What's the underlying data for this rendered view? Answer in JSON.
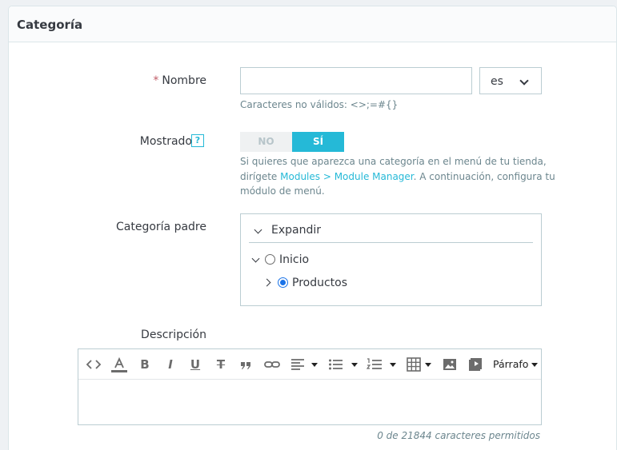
{
  "panel": {
    "title": "Categoría"
  },
  "name_field": {
    "required_mark": "*",
    "label": "Nombre",
    "value": "",
    "placeholder": "",
    "language": "es",
    "help": "Caracteres no válidos: <>;=#{}"
  },
  "displayed": {
    "label": "Mostrado",
    "help_icon": "?",
    "off_label": "NO",
    "on_label": "SÍ",
    "selected": "SÍ",
    "help_text_1": "Si quieres que aparezca una categoría en el menú de tu tienda,",
    "help_text_2_pre": "dirígete ",
    "help_link": "Modules > Module Manager",
    "help_text_2_post": ". A continuación, configura tu",
    "help_text_3": "módulo de menú."
  },
  "parent_category": {
    "label": "Categoría padre",
    "expand_label": "Expandir",
    "items": [
      {
        "label": "Inicio",
        "checked": false
      },
      {
        "label": "Productos",
        "checked": true
      }
    ]
  },
  "description": {
    "label": "Descripción",
    "paragraph_label": "Párrafo",
    "counter": "0 de 21844 caracteres permitidos",
    "toolbar_icons": [
      "source-code-icon",
      "text-color-icon",
      "bold-icon",
      "italic-icon",
      "underline-icon",
      "strikethrough-icon",
      "blockquote-icon",
      "link-icon",
      "align-icon",
      "bullet-list-icon",
      "numbered-list-icon",
      "table-icon",
      "image-icon",
      "media-icon"
    ]
  },
  "colors": {
    "accent": "#25b9d7",
    "required": "#c05c67",
    "border": "#bbcdd2"
  }
}
